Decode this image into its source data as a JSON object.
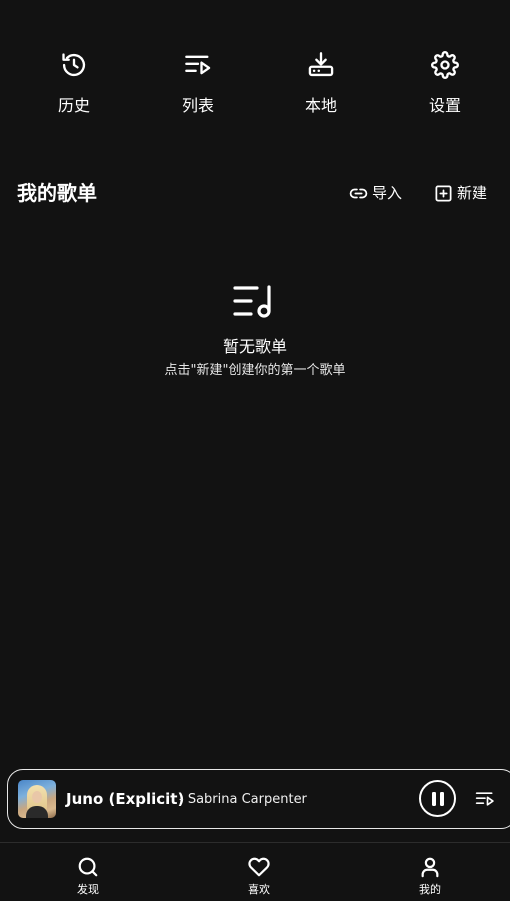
{
  "quick_access": [
    {
      "label": "历史",
      "icon": "history-icon"
    },
    {
      "label": "列表",
      "icon": "playlist-icon"
    },
    {
      "label": "本地",
      "icon": "download-icon"
    },
    {
      "label": "设置",
      "icon": "gear-icon"
    }
  ],
  "playlists": {
    "title": "我的歌单",
    "import_label": "导入",
    "new_label": "新建"
  },
  "empty_state": {
    "title": "暂无歌单",
    "hint": "点击\"新建\"创建你的第一个歌单"
  },
  "player": {
    "track_title": "Juno (Explicit)",
    "artist": "- Sabrina Carpenter",
    "state": "playing"
  },
  "bottom_nav": [
    {
      "label": "发现",
      "icon": "search-icon"
    },
    {
      "label": "喜欢",
      "icon": "heart-icon"
    },
    {
      "label": "我的",
      "icon": "user-icon"
    }
  ],
  "colors": {
    "background": "#121212",
    "foreground": "#ffffff"
  }
}
